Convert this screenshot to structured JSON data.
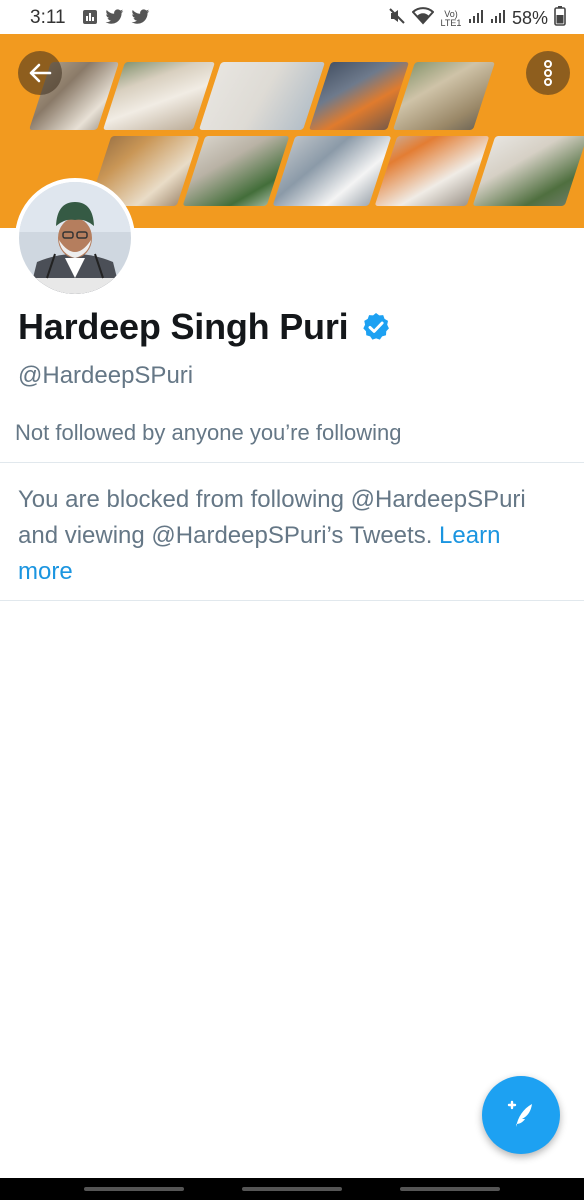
{
  "status_bar": {
    "time": "3:11",
    "network_label": "Vo) LTE1",
    "battery": "58%"
  },
  "header": {
    "back_icon": "arrow-left-icon",
    "more_icon": "more-vertical-icon",
    "banner_color": "#f29a1f"
  },
  "profile": {
    "display_name": "Hardeep Singh Puri",
    "verified_icon": "verified-badge-icon",
    "handle": "@HardeepSPuri",
    "follow_context": "Not followed by anyone you’re following"
  },
  "blocked": {
    "message": "You are blocked from following @HardeepSPuri and viewing @HardeepSPuri’s Tweets. ",
    "link_label": "Learn more"
  },
  "fab": {
    "icon": "compose-tweet-icon"
  },
  "colors": {
    "accent": "#1da1f2",
    "link": "#1b95e0",
    "secondary_text": "#657786",
    "primary_text": "#14171a"
  }
}
